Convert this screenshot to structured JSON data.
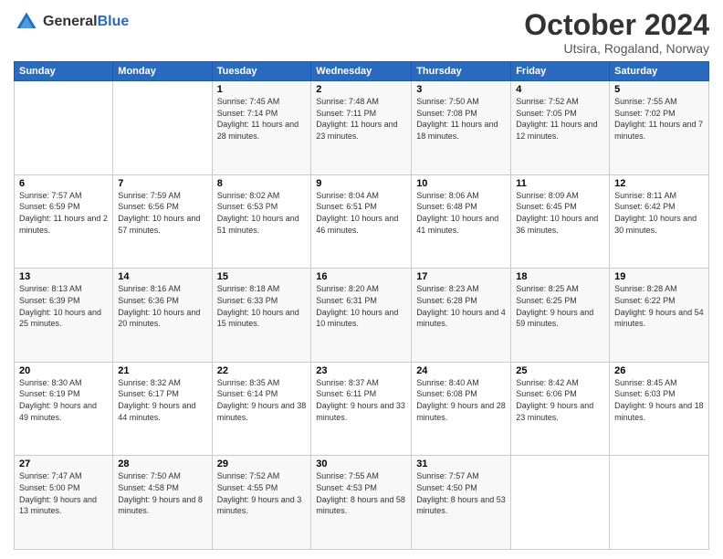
{
  "logo": {
    "text_general": "General",
    "text_blue": "Blue"
  },
  "header": {
    "month": "October 2024",
    "location": "Utsira, Rogaland, Norway"
  },
  "weekdays": [
    "Sunday",
    "Monday",
    "Tuesday",
    "Wednesday",
    "Thursday",
    "Friday",
    "Saturday"
  ],
  "weeks": [
    [
      null,
      null,
      {
        "day": 1,
        "sunrise": "Sunrise: 7:45 AM",
        "sunset": "Sunset: 7:14 PM",
        "daylight": "Daylight: 11 hours and 28 minutes."
      },
      {
        "day": 2,
        "sunrise": "Sunrise: 7:48 AM",
        "sunset": "Sunset: 7:11 PM",
        "daylight": "Daylight: 11 hours and 23 minutes."
      },
      {
        "day": 3,
        "sunrise": "Sunrise: 7:50 AM",
        "sunset": "Sunset: 7:08 PM",
        "daylight": "Daylight: 11 hours and 18 minutes."
      },
      {
        "day": 4,
        "sunrise": "Sunrise: 7:52 AM",
        "sunset": "Sunset: 7:05 PM",
        "daylight": "Daylight: 11 hours and 12 minutes."
      },
      {
        "day": 5,
        "sunrise": "Sunrise: 7:55 AM",
        "sunset": "Sunset: 7:02 PM",
        "daylight": "Daylight: 11 hours and 7 minutes."
      }
    ],
    [
      {
        "day": 6,
        "sunrise": "Sunrise: 7:57 AM",
        "sunset": "Sunset: 6:59 PM",
        "daylight": "Daylight: 11 hours and 2 minutes."
      },
      {
        "day": 7,
        "sunrise": "Sunrise: 7:59 AM",
        "sunset": "Sunset: 6:56 PM",
        "daylight": "Daylight: 10 hours and 57 minutes."
      },
      {
        "day": 8,
        "sunrise": "Sunrise: 8:02 AM",
        "sunset": "Sunset: 6:53 PM",
        "daylight": "Daylight: 10 hours and 51 minutes."
      },
      {
        "day": 9,
        "sunrise": "Sunrise: 8:04 AM",
        "sunset": "Sunset: 6:51 PM",
        "daylight": "Daylight: 10 hours and 46 minutes."
      },
      {
        "day": 10,
        "sunrise": "Sunrise: 8:06 AM",
        "sunset": "Sunset: 6:48 PM",
        "daylight": "Daylight: 10 hours and 41 minutes."
      },
      {
        "day": 11,
        "sunrise": "Sunrise: 8:09 AM",
        "sunset": "Sunset: 6:45 PM",
        "daylight": "Daylight: 10 hours and 36 minutes."
      },
      {
        "day": 12,
        "sunrise": "Sunrise: 8:11 AM",
        "sunset": "Sunset: 6:42 PM",
        "daylight": "Daylight: 10 hours and 30 minutes."
      }
    ],
    [
      {
        "day": 13,
        "sunrise": "Sunrise: 8:13 AM",
        "sunset": "Sunset: 6:39 PM",
        "daylight": "Daylight: 10 hours and 25 minutes."
      },
      {
        "day": 14,
        "sunrise": "Sunrise: 8:16 AM",
        "sunset": "Sunset: 6:36 PM",
        "daylight": "Daylight: 10 hours and 20 minutes."
      },
      {
        "day": 15,
        "sunrise": "Sunrise: 8:18 AM",
        "sunset": "Sunset: 6:33 PM",
        "daylight": "Daylight: 10 hours and 15 minutes."
      },
      {
        "day": 16,
        "sunrise": "Sunrise: 8:20 AM",
        "sunset": "Sunset: 6:31 PM",
        "daylight": "Daylight: 10 hours and 10 minutes."
      },
      {
        "day": 17,
        "sunrise": "Sunrise: 8:23 AM",
        "sunset": "Sunset: 6:28 PM",
        "daylight": "Daylight: 10 hours and 4 minutes."
      },
      {
        "day": 18,
        "sunrise": "Sunrise: 8:25 AM",
        "sunset": "Sunset: 6:25 PM",
        "daylight": "Daylight: 9 hours and 59 minutes."
      },
      {
        "day": 19,
        "sunrise": "Sunrise: 8:28 AM",
        "sunset": "Sunset: 6:22 PM",
        "daylight": "Daylight: 9 hours and 54 minutes."
      }
    ],
    [
      {
        "day": 20,
        "sunrise": "Sunrise: 8:30 AM",
        "sunset": "Sunset: 6:19 PM",
        "daylight": "Daylight: 9 hours and 49 minutes."
      },
      {
        "day": 21,
        "sunrise": "Sunrise: 8:32 AM",
        "sunset": "Sunset: 6:17 PM",
        "daylight": "Daylight: 9 hours and 44 minutes."
      },
      {
        "day": 22,
        "sunrise": "Sunrise: 8:35 AM",
        "sunset": "Sunset: 6:14 PM",
        "daylight": "Daylight: 9 hours and 38 minutes."
      },
      {
        "day": 23,
        "sunrise": "Sunrise: 8:37 AM",
        "sunset": "Sunset: 6:11 PM",
        "daylight": "Daylight: 9 hours and 33 minutes."
      },
      {
        "day": 24,
        "sunrise": "Sunrise: 8:40 AM",
        "sunset": "Sunset: 6:08 PM",
        "daylight": "Daylight: 9 hours and 28 minutes."
      },
      {
        "day": 25,
        "sunrise": "Sunrise: 8:42 AM",
        "sunset": "Sunset: 6:06 PM",
        "daylight": "Daylight: 9 hours and 23 minutes."
      },
      {
        "day": 26,
        "sunrise": "Sunrise: 8:45 AM",
        "sunset": "Sunset: 6:03 PM",
        "daylight": "Daylight: 9 hours and 18 minutes."
      }
    ],
    [
      {
        "day": 27,
        "sunrise": "Sunrise: 7:47 AM",
        "sunset": "Sunset: 5:00 PM",
        "daylight": "Daylight: 9 hours and 13 minutes."
      },
      {
        "day": 28,
        "sunrise": "Sunrise: 7:50 AM",
        "sunset": "Sunset: 4:58 PM",
        "daylight": "Daylight: 9 hours and 8 minutes."
      },
      {
        "day": 29,
        "sunrise": "Sunrise: 7:52 AM",
        "sunset": "Sunset: 4:55 PM",
        "daylight": "Daylight: 9 hours and 3 minutes."
      },
      {
        "day": 30,
        "sunrise": "Sunrise: 7:55 AM",
        "sunset": "Sunset: 4:53 PM",
        "daylight": "Daylight: 8 hours and 58 minutes."
      },
      {
        "day": 31,
        "sunrise": "Sunrise: 7:57 AM",
        "sunset": "Sunset: 4:50 PM",
        "daylight": "Daylight: 8 hours and 53 minutes."
      },
      null,
      null
    ]
  ]
}
